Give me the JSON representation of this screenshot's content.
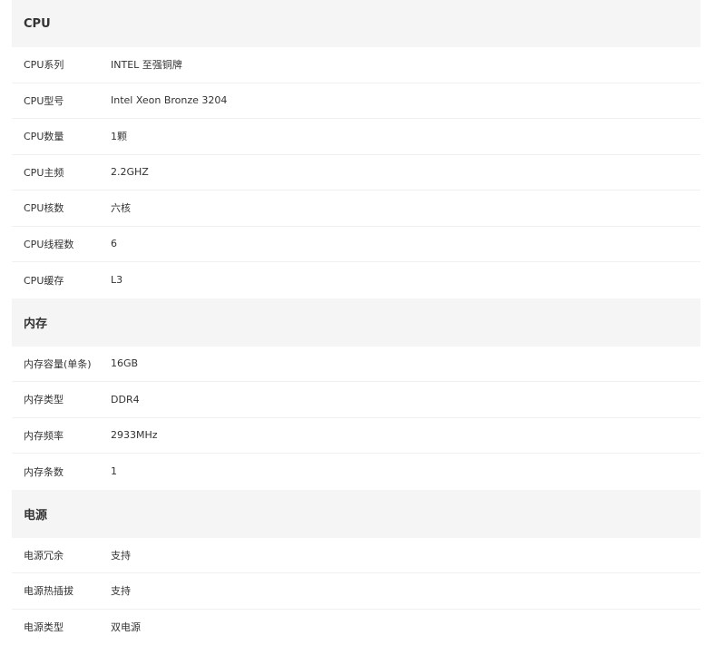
{
  "sections": [
    {
      "title": "CPU",
      "rows": [
        {
          "label": "CPU系列",
          "value": "INTEL 至强铜牌"
        },
        {
          "label": "CPU型号",
          "value": "Intel Xeon Bronze 3204"
        },
        {
          "label": "CPU数量",
          "value": "1颗"
        },
        {
          "label": "CPU主频",
          "value": "2.2GHZ"
        },
        {
          "label": "CPU核数",
          "value": "六核"
        },
        {
          "label": "CPU线程数",
          "value": "6"
        },
        {
          "label": "CPU缓存",
          "value": "L3"
        }
      ]
    },
    {
      "title": "内存",
      "rows": [
        {
          "label": "内存容量(单条)",
          "value": "16GB"
        },
        {
          "label": "内存类型",
          "value": "DDR4"
        },
        {
          "label": "内存频率",
          "value": "2933MHz"
        },
        {
          "label": "内存条数",
          "value": "1"
        }
      ]
    },
    {
      "title": "电源",
      "rows": [
        {
          "label": "电源冗余",
          "value": "支持"
        },
        {
          "label": "电源热插拔",
          "value": "支持"
        },
        {
          "label": "电源类型",
          "value": "双电源"
        }
      ]
    }
  ]
}
